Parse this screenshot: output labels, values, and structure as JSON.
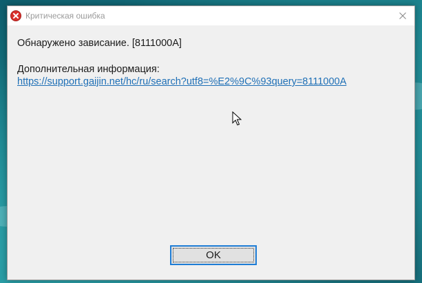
{
  "window": {
    "title": "Критическая ошибка",
    "icon": "error-icon",
    "close_icon": "close-icon"
  },
  "message": {
    "text": "Обнаружено зависание. [8111000A]"
  },
  "additional_info": {
    "label": "Дополнительная информация:",
    "link_text": "https://support.gaijin.net/hc/ru/search?utf8=%E2%9C%93query=8111000A"
  },
  "buttons": {
    "ok_label": "OK"
  },
  "colors": {
    "error_red": "#d9302c",
    "link_blue": "#1e6fb6",
    "focus_border": "#1e7dd6",
    "dialog_bg": "#f0f0f0"
  }
}
